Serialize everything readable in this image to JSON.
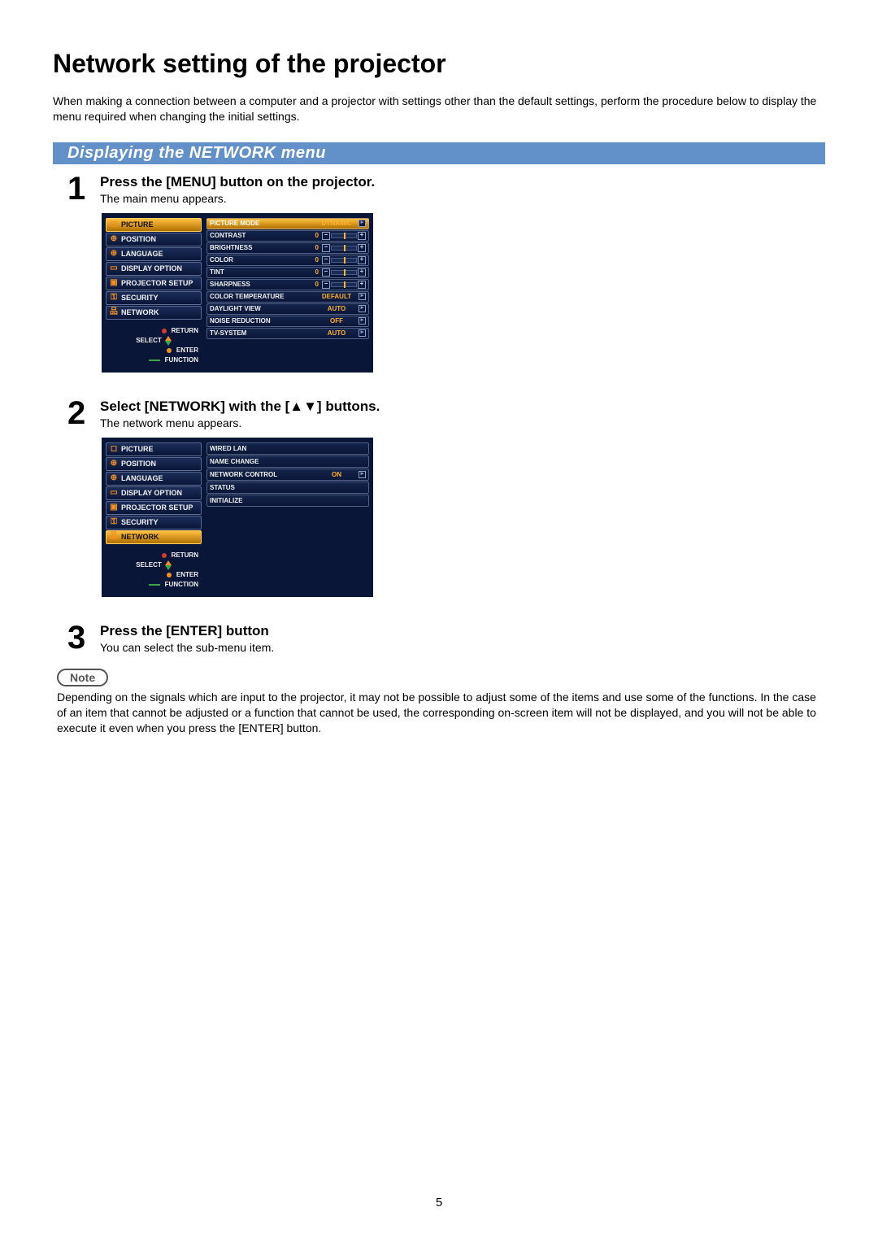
{
  "title": "Network setting of the projector",
  "intro": "When making a connection between a computer and a projector with settings other than the default settings, perform the procedure below to display the menu required when changing the initial settings.",
  "section_heading": "Displaying the NETWORK menu",
  "steps": {
    "s1": {
      "num": "1",
      "heading": "Press the [MENU] button on the projector.",
      "note": "The main menu appears."
    },
    "s2": {
      "num": "2",
      "heading": "Select [NETWORK] with the [▲▼] buttons.",
      "note": "The network menu appears."
    },
    "s3": {
      "num": "3",
      "heading": "Press the [ENTER] button",
      "note": "You can select the sub-menu item."
    }
  },
  "menu_items": [
    "PICTURE",
    "POSITION",
    "LANGUAGE",
    "DISPLAY OPTION",
    "PROJECTOR SETUP",
    "SECURITY",
    "NETWORK"
  ],
  "nav_hints": {
    "return": "RETURN",
    "select": "SELECT",
    "enter": "ENTER",
    "function": "FUNCTION"
  },
  "osd1_right": [
    {
      "label": "PICTURE MODE",
      "type": "pill",
      "value": "DYNAMIC"
    },
    {
      "label": "CONTRAST",
      "type": "slider",
      "value": "0"
    },
    {
      "label": "BRIGHTNESS",
      "type": "slider",
      "value": "0"
    },
    {
      "label": "COLOR",
      "type": "slider",
      "value": "0"
    },
    {
      "label": "TINT",
      "type": "slider",
      "value": "0"
    },
    {
      "label": "SHARPNESS",
      "type": "slider",
      "value": "0"
    },
    {
      "label": "COLOR TEMPERATURE",
      "type": "pill",
      "value": "DEFAULT"
    },
    {
      "label": "DAYLIGHT VIEW",
      "type": "pill",
      "value": "AUTO"
    },
    {
      "label": "NOISE REDUCTION",
      "type": "pill",
      "value": "OFF"
    },
    {
      "label": "TV-SYSTEM",
      "type": "pill",
      "value": "AUTO"
    }
  ],
  "osd2_right": [
    {
      "label": "WIRED LAN",
      "type": "plain"
    },
    {
      "label": "NAME CHANGE",
      "type": "plain"
    },
    {
      "label": "NETWORK CONTROL",
      "type": "pill",
      "value": "ON"
    },
    {
      "label": "STATUS",
      "type": "plain"
    },
    {
      "label": "INITIALIZE",
      "type": "plain"
    }
  ],
  "osd1_selected_index": 0,
  "osd2_selected_index": 6,
  "note_label": "Note",
  "note_text": "Depending on the signals which are input to the projector, it may not be possible to adjust some of the items and use some of the functions. In the case of an item that cannot be adjusted or a function that cannot be used, the corresponding on-screen item will not be displayed, and you will not be able to execute it even when you press the [ENTER] button.",
  "page_number": "5",
  "menu_icons": [
    "◻",
    "⊕",
    "⊕",
    "▭",
    "▣",
    "⚿",
    "品"
  ]
}
